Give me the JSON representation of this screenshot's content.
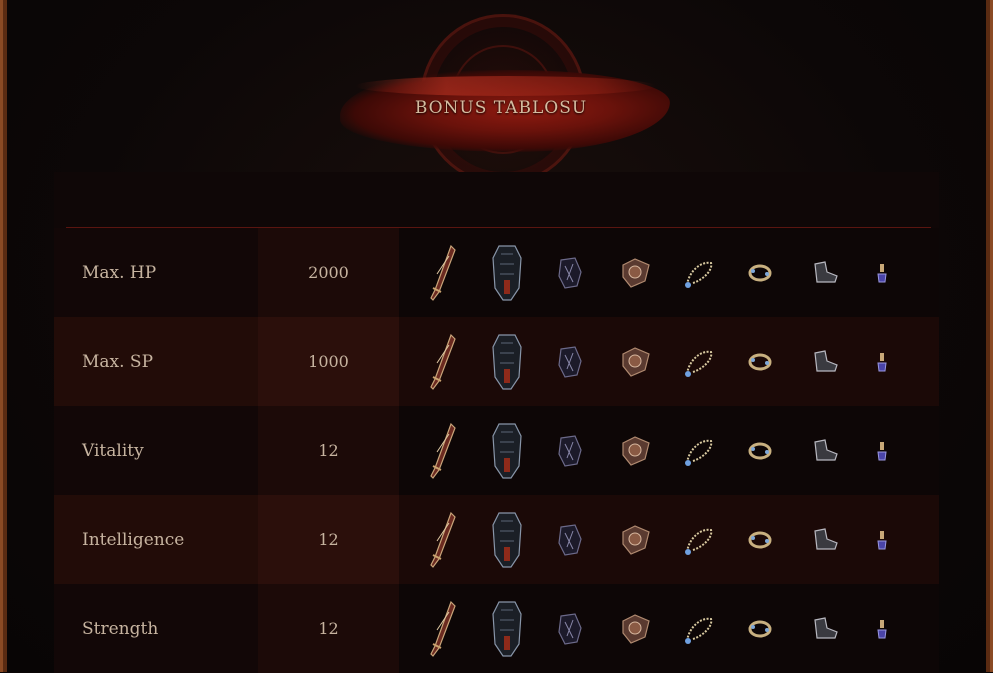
{
  "header": {
    "title": "BONUS TABLOSU"
  },
  "bonuses": [
    {
      "name": "Max. HP",
      "value": "2000"
    },
    {
      "name": "Max. SP",
      "value": "1000"
    },
    {
      "name": "Vitality",
      "value": "12"
    },
    {
      "name": "Intelligence",
      "value": "12"
    },
    {
      "name": "Strength",
      "value": "12"
    }
  ],
  "equipment_icons": [
    "weapon-icon",
    "armor-icon",
    "helmet-icon",
    "shield-icon",
    "necklace-icon",
    "bracelet-icon",
    "shoes-icon",
    "earring-icon"
  ],
  "colors": {
    "accent_red": "#8e1a10",
    "text": "#c7b4a0",
    "frame": "#5a2b12"
  }
}
